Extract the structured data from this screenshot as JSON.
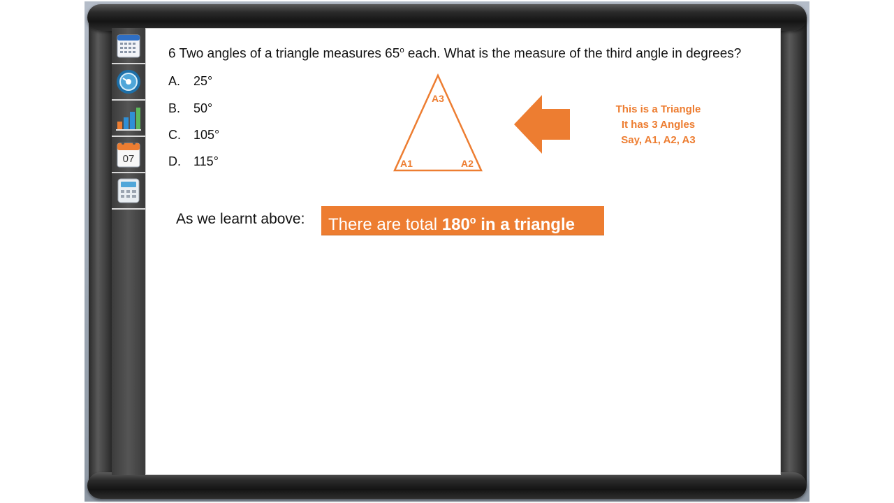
{
  "question": {
    "number": "6",
    "text_before": "Two angles of a triangle measures 65",
    "degree_mark": "o",
    "text_after": " each. What is the measure of the third angle in degrees?"
  },
  "options": [
    {
      "letter": "A.",
      "value": "25°"
    },
    {
      "letter": "B.",
      "value": "50°"
    },
    {
      "letter": "C.",
      "value": "105°"
    },
    {
      "letter": "D.",
      "value": "115°"
    }
  ],
  "triangle": {
    "top_label": "A3",
    "left_label": "A1",
    "right_label": "A2"
  },
  "note": {
    "line1": "This is a Triangle",
    "line2": "It has 3 Angles",
    "line3": "Say, A1, A2, A3"
  },
  "learnt_label": "As we learnt above:",
  "banner": {
    "text_before": "There are total ",
    "bold_value": "180",
    "degree_mark": "o",
    "bold_after": " in a triangle"
  },
  "sidebar": {
    "items": [
      {
        "icon": "calendar-grid-icon"
      },
      {
        "icon": "gauge-icon"
      },
      {
        "icon": "bar-chart-icon"
      },
      {
        "icon": "date-calendar-icon",
        "label": "07"
      },
      {
        "icon": "calculator-icon"
      }
    ]
  },
  "colors": {
    "accent": "#ed7d31",
    "text": "#111111",
    "canvas": "#ffffff"
  }
}
